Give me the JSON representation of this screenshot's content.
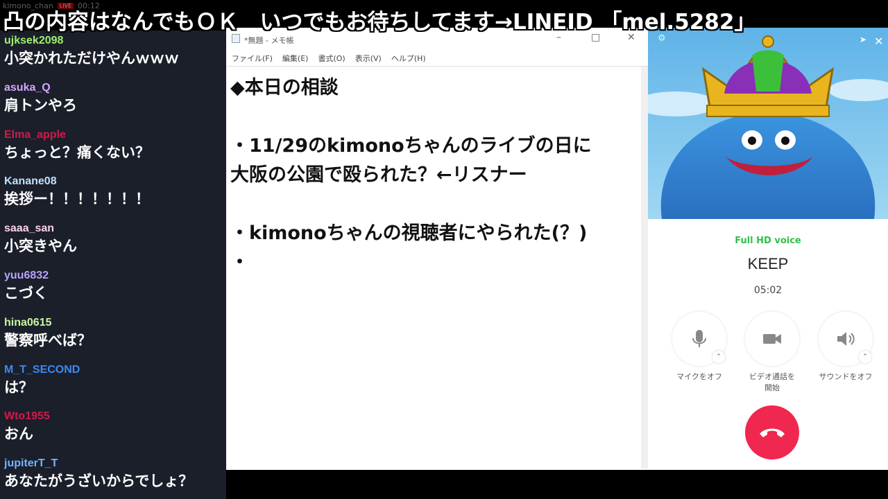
{
  "banner": {
    "text": "凸の内容はなんでもＯＫ　いつでもお待ちしてます→LINEID 「mel.5282」"
  },
  "stream_bar": {
    "channel": "kimono_chan",
    "live_label": "LIVE",
    "elapsed": "00:12"
  },
  "chat": {
    "messages": [
      {
        "user": "ujksek2098",
        "color": "#9ff06f",
        "text": "小突かれただけやんｗｗｗ"
      },
      {
        "user": "asuka_Q",
        "color": "#d7a6ff",
        "text": "肩トンやろ"
      },
      {
        "user": "Elma_apple",
        "color": "#d11a4a",
        "text": "ちょっと？痛くない？"
      },
      {
        "user": "Kanane08",
        "color": "#bfe0ff",
        "text": "挨拶ー！！！！！！！"
      },
      {
        "user": "saaa_san",
        "color": "#ffd1e6",
        "text": "小突きやん"
      },
      {
        "user": "yuu6832",
        "color": "#b7a4ff",
        "text": "こづく"
      },
      {
        "user": "hina0615",
        "color": "#c8f7a4",
        "text": "警察呼べば？"
      },
      {
        "user": "M_T_SECOND",
        "color": "#3a8bf0",
        "text": "は？"
      },
      {
        "user": "Wto1955",
        "color": "#d11a4a",
        "text": "おん"
      },
      {
        "user": "jupiterT_T",
        "color": "#6fb4ff",
        "text": "あなたがうざいからでしょ？"
      }
    ]
  },
  "notepad": {
    "title": "*無題 - メモ帳",
    "menu": [
      "ファイル(F)",
      "編集(E)",
      "書式(O)",
      "表示(V)",
      "ヘルプ(H)"
    ],
    "lines": [
      "◆本日の相談",
      "",
      "・11/29のkimonoちゃんのライブの日に",
      "大阪の公園で殴られた？←リスナー",
      "",
      "・kimonoちゃんの視聴者にやられた(？)",
      "・"
    ]
  },
  "call": {
    "voice_label": "Full HD voice",
    "contact_name": "KEEP",
    "duration": "05:02",
    "buttons": [
      {
        "label": "マイクをオフ",
        "icon": "microphone-icon"
      },
      {
        "label": "ビデオ通話を\n開始",
        "icon": "video-camera-icon"
      },
      {
        "label": "サウンドをオフ",
        "icon": "speaker-icon"
      }
    ],
    "hangup_color": "#f0274e",
    "accent": "#2ec14a"
  }
}
